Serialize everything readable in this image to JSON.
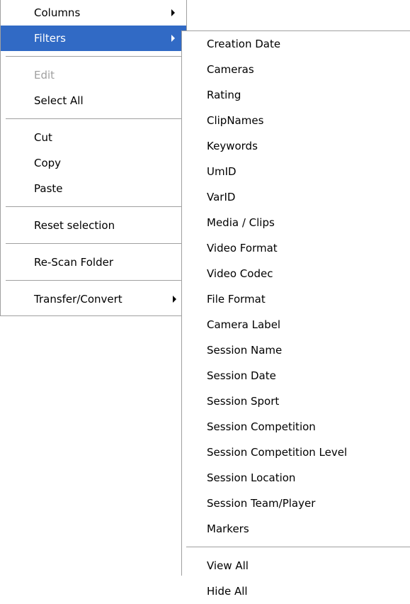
{
  "context_menu": {
    "columns": "Columns",
    "filters": "Filters",
    "edit": "Edit",
    "select_all": "Select All",
    "cut": "Cut",
    "copy": "Copy",
    "paste": "Paste",
    "reset_selection": "Reset selection",
    "rescan_folder": "Re-Scan Folder",
    "transfer_convert": "Transfer/Convert"
  },
  "filters_submenu": {
    "items": [
      "Creation Date",
      "Cameras",
      "Rating",
      "ClipNames",
      "Keywords",
      "UmID",
      "VarID",
      "Media / Clips",
      "Video Format",
      "Video Codec",
      "File Format",
      "Camera Label",
      "Session Name",
      "Session Date",
      "Session Sport",
      "Session Competition",
      "Session Competition Level",
      "Session Location",
      "Session Team/Player",
      "Markers"
    ],
    "view_all": "View All",
    "hide_all": "Hide All"
  },
  "colors": {
    "highlight": "#316ac5",
    "disabled_text": "#a0a0a0",
    "menu_background": "#ffffff"
  }
}
